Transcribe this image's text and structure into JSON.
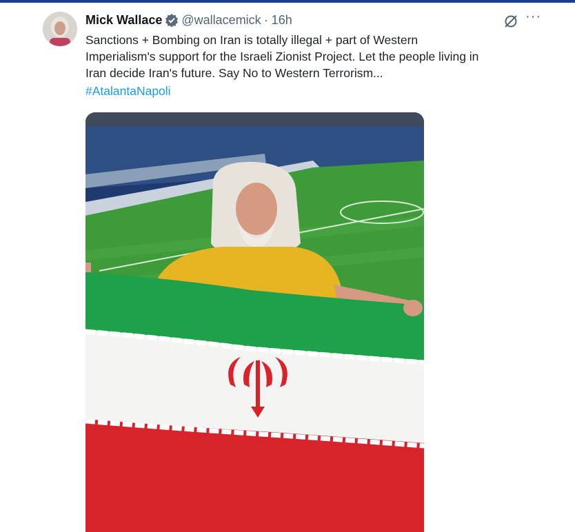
{
  "tweet": {
    "author_name": "Mick Wallace",
    "handle": "@wallacemick",
    "time": "· 16h",
    "lines": [
      "Sanctions + Bombing on Iran is totally illegal + part of Western",
      "Imperialism's support for the Israeli Zionist Project. Let the people living in",
      "Iran decide Iran's future. Say No to Western Terrorism..."
    ],
    "hashtag": "#AtalantaNapoli",
    "more_label": "···"
  },
  "icons": {
    "verified": "verified-badge-icon",
    "grok": "grok-icon",
    "more": "more-options-icon"
  },
  "colors": {
    "link": "#1d9bf0",
    "verified": "#1d9bf0",
    "secondary_text": "#536471",
    "flag_green": "#1fa04a",
    "flag_white": "#f4f4f2",
    "flag_red": "#d8232a"
  }
}
